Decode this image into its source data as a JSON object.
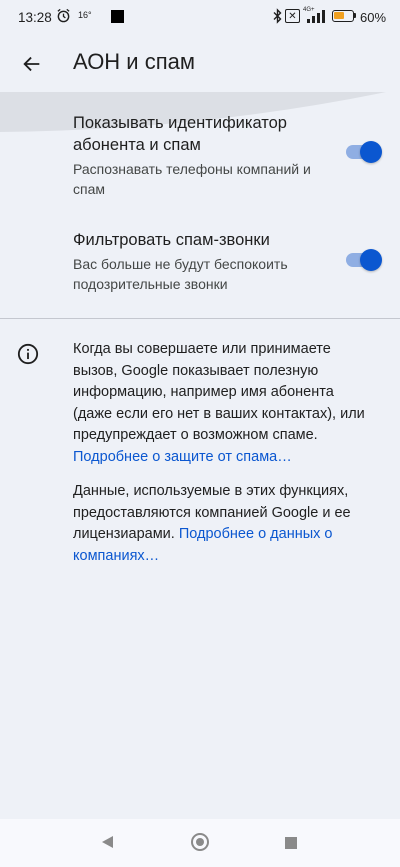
{
  "status_bar": {
    "time": "13:28",
    "temperature": "16°",
    "network": "4G+",
    "sim_badge": "✕",
    "battery_percent": "60%",
    "battery_level": 0.6,
    "battery_color": "#f0a020"
  },
  "app_bar": {
    "back_icon": "arrow-back-icon",
    "title": "АОН и спам"
  },
  "settings": [
    {
      "title": "Показывать идентификатор абонента и спам",
      "summary": "Распознавать телефоны компаний и спам",
      "enabled": true
    },
    {
      "title": "Фильтровать спам-звонки",
      "summary": "Вас больше не будут беспокоить подозрительные звонки",
      "enabled": true
    }
  ],
  "info": {
    "icon": "info-icon",
    "paragraph1": "Когда вы совершаете или принимаете вызов, Google показывает полезную информацию, например имя абонента (даже если его нет в ваших контактах), или предупреждает о возможном спаме. ",
    "link1": "Подробнее о защите от спама…",
    "paragraph2": "Данные, используемые в этих функциях, предоставляются компанией Google и ее лицензиарами. ",
    "link2": "Подробнее о данных о компаниях…"
  },
  "colors": {
    "accent": "#0b57d0",
    "toggle_track": "#8faee3",
    "background": "#eef1f7"
  },
  "nav_bar": {
    "back_icon": "nav-back-icon",
    "home_icon": "nav-home-icon",
    "recents_icon": "nav-recents-icon"
  }
}
